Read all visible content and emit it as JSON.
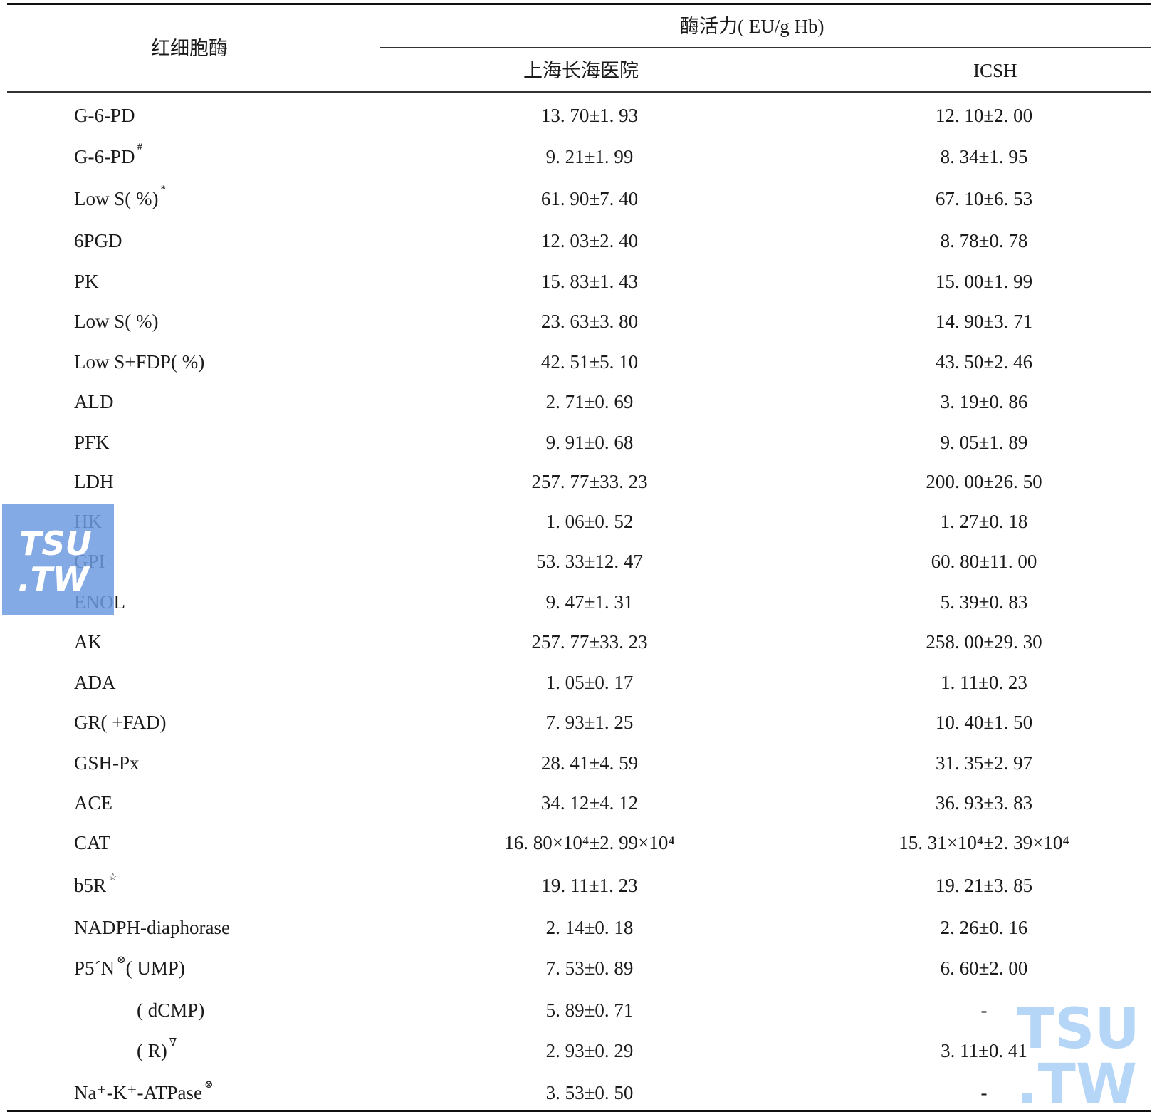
{
  "table": {
    "header": {
      "enzyme": "红细胞酶",
      "activity": "酶活力( EU/g Hb)",
      "col1": "上海长海医院",
      "col2": "ICSH"
    },
    "rows": [
      {
        "name": "G-6-PD",
        "sup": "",
        "suffix": "",
        "v1": "13. 70±1. 93",
        "v2": "12. 10±2. 00"
      },
      {
        "name": "G-6-PD",
        "sup": "#",
        "suffix": "",
        "v1": "9. 21±1. 99",
        "v2": "8. 34±1. 95"
      },
      {
        "name": "Low S( %)",
        "sup": "*",
        "suffix": "",
        "v1": "61. 90±7. 40",
        "v2": "67. 10±6. 53"
      },
      {
        "name": "6PGD",
        "sup": "",
        "suffix": "",
        "v1": "12. 03±2. 40",
        "v2": "8. 78±0. 78"
      },
      {
        "name": "PK",
        "sup": "",
        "suffix": "",
        "v1": "15. 83±1. 43",
        "v2": "15. 00±1. 99"
      },
      {
        "name": "Low S( %)",
        "sup": "",
        "suffix": "",
        "v1": "23. 63±3. 80",
        "v2": "14. 90±3. 71"
      },
      {
        "name": "Low S+FDP( %)",
        "sup": "",
        "suffix": "",
        "v1": "42. 51±5. 10",
        "v2": "43. 50±2. 46"
      },
      {
        "name": "ALD",
        "sup": "",
        "suffix": "",
        "v1": "2. 71±0. 69",
        "v2": "3. 19±0. 86"
      },
      {
        "name": "PFK",
        "sup": "",
        "suffix": "",
        "v1": "9. 91±0. 68",
        "v2": "9. 05±1. 89"
      },
      {
        "name": "LDH",
        "sup": "",
        "suffix": "",
        "v1": "257. 77±33. 23",
        "v2": "200. 00±26. 50"
      },
      {
        "name": "HK",
        "sup": "",
        "suffix": "",
        "v1": "1. 06±0. 52",
        "v2": "1. 27±0. 18"
      },
      {
        "name": "GPI",
        "sup": "",
        "suffix": "",
        "v1": "53. 33±12. 47",
        "v2": "60. 80±11. 00"
      },
      {
        "name": "ENOL",
        "sup": "",
        "suffix": "",
        "v1": "9. 47±1. 31",
        "v2": "5. 39±0. 83"
      },
      {
        "name": "AK",
        "sup": "",
        "suffix": "",
        "v1": "257. 77±33. 23",
        "v2": "258. 00±29. 30"
      },
      {
        "name": "ADA",
        "sup": "",
        "suffix": "",
        "v1": "1. 05±0. 17",
        "v2": "1. 11±0. 23"
      },
      {
        "name": "GR( +FAD)",
        "sup": "",
        "suffix": "",
        "v1": "7. 93±1. 25",
        "v2": "10. 40±1. 50"
      },
      {
        "name": "GSH-Px",
        "sup": "",
        "suffix": "",
        "v1": "28. 41±4. 59",
        "v2": "31. 35±2. 97"
      },
      {
        "name": "ACE",
        "sup": "",
        "suffix": "",
        "v1": "34. 12±4. 12",
        "v2": "36. 93±3. 83"
      },
      {
        "name": "CAT",
        "sup": "",
        "suffix": "",
        "v1": "16. 80×10⁴±2. 99×10⁴",
        "v2": "15. 31×10⁴±2. 39×10⁴"
      },
      {
        "name": "b5R",
        "sup": "☆",
        "suffix": "",
        "v1": "19. 11±1. 23",
        "v2": "19. 21±3. 85"
      },
      {
        "name": "NADPH-diaphorase",
        "sup": "",
        "suffix": "",
        "v1": "2. 14±0. 18",
        "v2": "2. 26±0. 16"
      },
      {
        "name": "P5´N",
        "sup": "⊗",
        "suffix": "( UMP)",
        "v1": "7. 53±0. 89",
        "v2": "6. 60±2. 00"
      },
      {
        "name": "( dCMP)",
        "sup": "",
        "suffix": "",
        "indent": true,
        "v1": "5. 89±0. 71",
        "v2": "-"
      },
      {
        "name": "( R)",
        "sup": "∇",
        "suffix": "",
        "indent": true,
        "v1": "2. 93±0. 29",
        "v2": "3. 11±0. 41"
      },
      {
        "name": "Na⁺-K⁺-ATPase",
        "sup": "⊗",
        "suffix": "",
        "v1": "3. 53±0. 50",
        "v2": "-"
      }
    ]
  },
  "watermark": {
    "line1": "TSU",
    "line2": ".TW",
    "color": "#6e9be1"
  }
}
